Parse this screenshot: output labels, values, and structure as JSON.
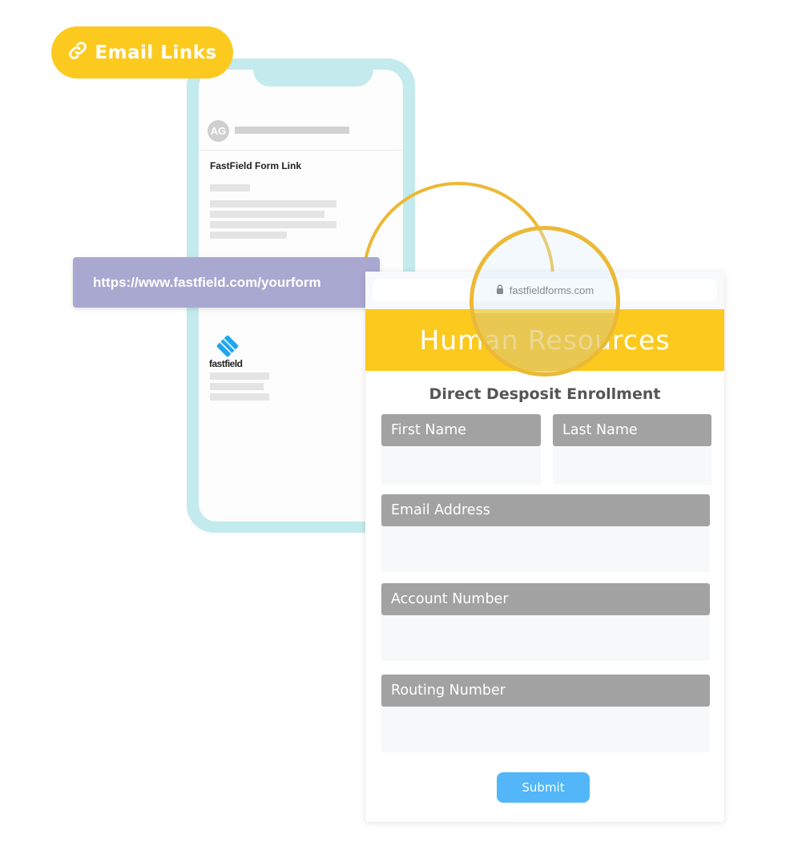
{
  "badge": {
    "label": "Email Links",
    "icon": "link-icon"
  },
  "phone": {
    "avatar_initials": "AG",
    "email_subject": "FastField Form Link",
    "logo_text": "fastfield"
  },
  "url_banner": {
    "text": "https://www.fastfield.com/yourform"
  },
  "browser": {
    "domain": "fastfieldforms.com",
    "icon": "lock-icon"
  },
  "form": {
    "header": "Human Resources",
    "title": "Direct Desposit Enrollment",
    "fields": [
      {
        "label": "First Name",
        "value": ""
      },
      {
        "label": "Last Name",
        "value": ""
      },
      {
        "label": "Email Address",
        "value": ""
      },
      {
        "label": "Account Number",
        "value": ""
      },
      {
        "label": "Routing Number",
        "value": ""
      }
    ],
    "submit_label": "Submit"
  },
  "colors": {
    "yellow": "#FCCA1E",
    "phone_frame": "#C3EAEC",
    "url_banner": "#A9A8D1",
    "field_label": "#A2A2A2",
    "submit": "#52B6F9",
    "magnifier_ring": "#EBB935"
  }
}
